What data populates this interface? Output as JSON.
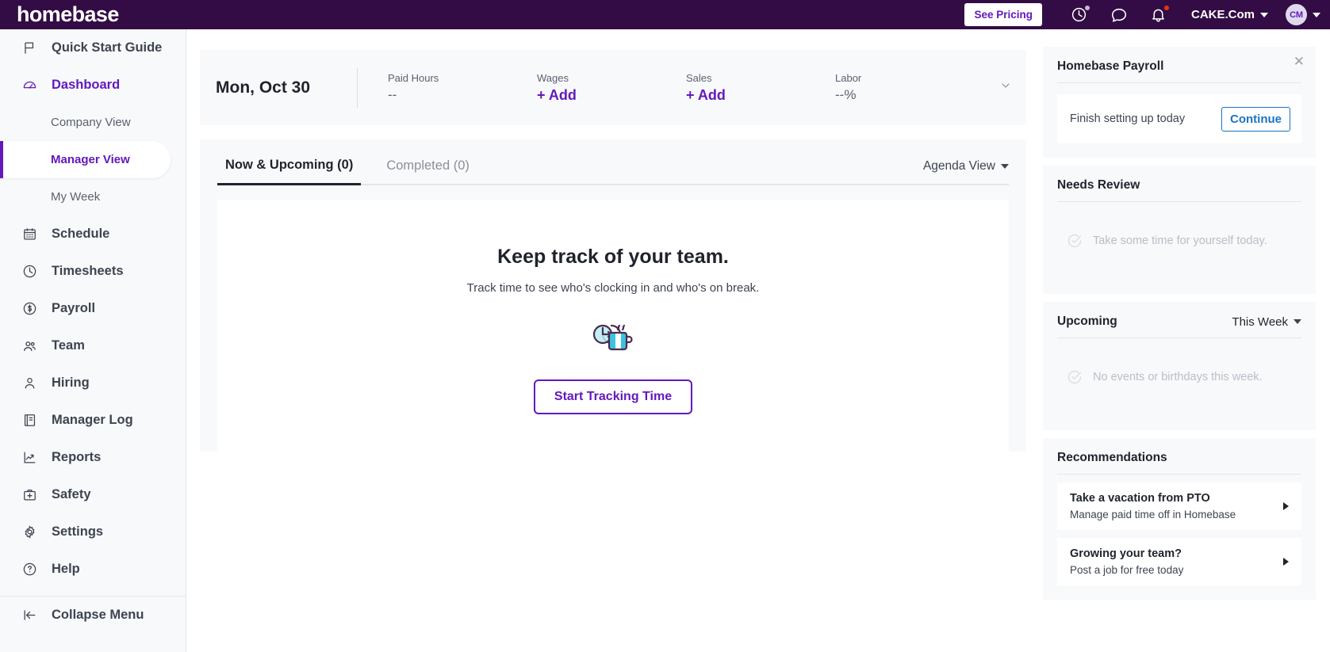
{
  "topbar": {
    "brand": "homebase",
    "pricing_label": "See Pricing",
    "account_name": "CAKE.Com",
    "avatar_initials": "CM",
    "icons": [
      "time-history-icon",
      "chat-bubble-icon",
      "bell-icon"
    ],
    "accent_purple": "#330c45",
    "badge_red": "#e8350d"
  },
  "sidebar": {
    "items": [
      {
        "label": "Quick Start Guide",
        "icon": "flag-icon"
      },
      {
        "label": "Dashboard",
        "icon": "speedometer-icon"
      },
      {
        "label": "Schedule",
        "icon": "calendar-icon"
      },
      {
        "label": "Timesheets",
        "icon": "clock-icon"
      },
      {
        "label": "Payroll",
        "icon": "dollar-circle-icon"
      },
      {
        "label": "Team",
        "icon": "people-icon"
      },
      {
        "label": "Hiring",
        "icon": "person-icon"
      },
      {
        "label": "Manager Log",
        "icon": "book-icon"
      },
      {
        "label": "Reports",
        "icon": "chart-line-icon"
      },
      {
        "label": "Safety",
        "icon": "first-aid-kit-icon"
      },
      {
        "label": "Settings",
        "icon": "gear-icon"
      },
      {
        "label": "Help",
        "icon": "question-circle-icon"
      }
    ],
    "dashboard_subitems": [
      {
        "label": "Company View"
      },
      {
        "label": "Manager View"
      },
      {
        "label": "My Week"
      }
    ],
    "collapse_label": "Collapse Menu",
    "active_item": "Dashboard",
    "selected_subitem": "Manager View",
    "accent": "#6319be"
  },
  "stats": {
    "date": "Mon, Oct 30",
    "metrics": [
      {
        "label": "Paid Hours",
        "value": "--",
        "style": "plain"
      },
      {
        "label": "Wages",
        "value": "+ Add",
        "style": "purple"
      },
      {
        "label": "Sales",
        "value": "+ Add",
        "style": "purple"
      },
      {
        "label": "Labor",
        "value": "--%",
        "style": "plain"
      }
    ]
  },
  "panel": {
    "tabs": [
      {
        "label": "Now & Upcoming (0)",
        "active": true
      },
      {
        "label": "Completed (0)",
        "active": false
      }
    ],
    "view_selector": "Agenda View",
    "empty_state": {
      "title": "Keep track of your team.",
      "subtitle": "Track time to see who's clocking in and who's on break.",
      "illustration": "clock-coffee-mug-icon",
      "button_label": "Start Tracking Time"
    }
  },
  "rail": {
    "payroll": {
      "title": "Homebase Payroll",
      "row_text": "Finish setting up today",
      "button_label": "Continue",
      "button_color": "#1a73c4",
      "close_icon": "close-icon"
    },
    "needs_review": {
      "title": "Needs Review",
      "empty_text": "Take some time for yourself today."
    },
    "upcoming": {
      "title": "Upcoming",
      "range_label": "This Week",
      "empty_text": "No events or birthdays this week."
    },
    "recommendations": {
      "title": "Recommendations",
      "items": [
        {
          "title": "Take a vacation from PTO",
          "subtitle": "Manage paid time off in Homebase"
        },
        {
          "title": "Growing your team?",
          "subtitle": "Post a job for free today"
        }
      ]
    }
  }
}
